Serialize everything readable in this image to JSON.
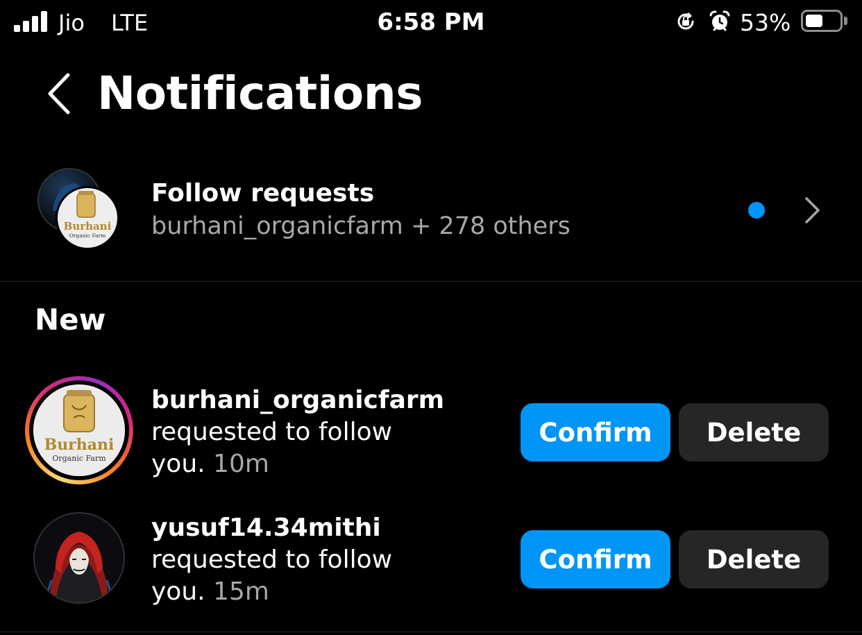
{
  "status_bar": {
    "carrier": "Jio",
    "network": "LTE",
    "time": "6:58 PM",
    "battery_percent": "53%",
    "battery_level": 0.53,
    "icons": [
      "signal-icon",
      "orientation-lock-icon",
      "alarm-icon",
      "battery-icon"
    ]
  },
  "header": {
    "back_icon": "chevron-left-icon",
    "title": "Notifications"
  },
  "follow_requests": {
    "title": "Follow requests",
    "subtitle": "burhani_organicfarm + 278 others",
    "unread_dot_color": "#0095f6",
    "chevron_icon": "chevron-right-icon",
    "avatar_logo_top": "Burhani",
    "avatar_logo_bottom": "Organic Farm"
  },
  "section_title": "New",
  "notifications": [
    {
      "username": "burhani_organicfarm",
      "action_text": "requested to follow you.",
      "time_ago": "10m",
      "confirm_label": "Confirm",
      "delete_label": "Delete",
      "logo_top": "Burhani",
      "logo_bottom": "Organic Farm",
      "has_story_ring": true
    },
    {
      "username": "yusuf14.34mithi",
      "action_text": "requested to follow you.",
      "time_ago": "15m",
      "confirm_label": "Confirm",
      "delete_label": "Delete",
      "has_story_ring": false
    }
  ],
  "colors": {
    "background": "#000000",
    "primary_blue": "#0095f6",
    "secondary_button": "#262626",
    "muted_text": "#a8a8a8"
  }
}
